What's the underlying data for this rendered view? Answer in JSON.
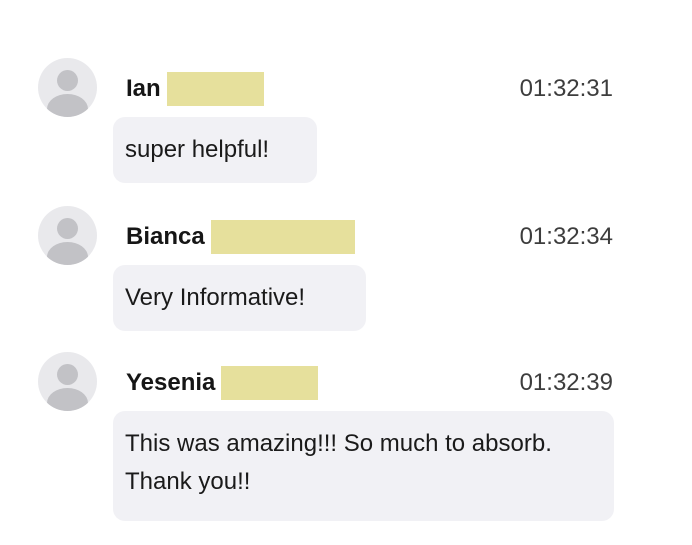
{
  "messages": [
    {
      "sender": "Ian",
      "time": "01:32:31",
      "text": "super helpful!"
    },
    {
      "sender": "Bianca",
      "time": "01:32:34",
      "text": "Very Informative!"
    },
    {
      "sender": "Yesenia",
      "time": "01:32:39",
      "text": "This was amazing!!! So much to absorb. Thank you!!"
    }
  ],
  "colors": {
    "bubble_background": "#f1f1f5",
    "redaction_highlight": "#e6e09c",
    "avatar_background": "#e9e9ec",
    "avatar_figure": "#c2c2c6"
  }
}
